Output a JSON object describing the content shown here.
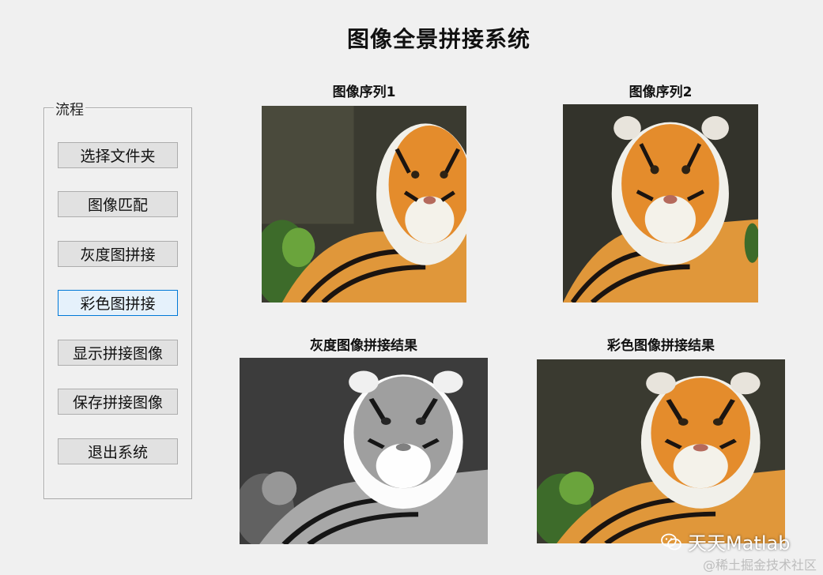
{
  "window": {
    "title": "图像全景拼接系统"
  },
  "panel": {
    "legend": "流程",
    "buttons": [
      {
        "label": "选择文件夹"
      },
      {
        "label": "图像匹配"
      },
      {
        "label": "灰度图拼接"
      },
      {
        "label": "彩色图拼接",
        "focused": true
      },
      {
        "label": "显示拼接图像"
      },
      {
        "label": "保存拼接图像"
      },
      {
        "label": "退出系统"
      }
    ]
  },
  "images": {
    "seq1": {
      "caption": "图像序列1"
    },
    "seq2": {
      "caption": "图像序列2"
    },
    "gray_result": {
      "caption": "灰度图像拼接结果"
    },
    "color_result": {
      "caption": "彩色图像拼接结果"
    }
  },
  "watermark": {
    "brand": "天天Matlab",
    "site": "@稀土掘金技术社区"
  },
  "colors": {
    "background": "#f0f0f0",
    "button_face": "#e1e1e1",
    "button_focus_border": "#0078d7",
    "button_focus_face": "#e5f1fb"
  },
  "icons": {
    "watermark_logo": "wechat-icon"
  }
}
